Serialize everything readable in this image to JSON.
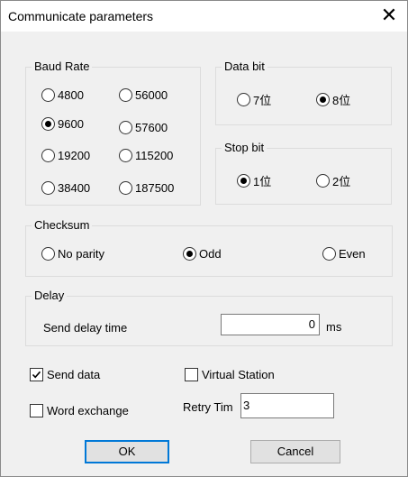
{
  "window": {
    "title": "Communicate parameters",
    "close_glyph": "✕"
  },
  "baud_rate": {
    "label": "Baud Rate",
    "options": [
      "4800",
      "56000",
      "9600",
      "57600",
      "19200",
      "115200",
      "38400",
      "187500"
    ],
    "selected": "9600"
  },
  "data_bit": {
    "label": "Data bit",
    "options": [
      "7位",
      "8位"
    ],
    "selected": "8位"
  },
  "stop_bit": {
    "label": "Stop bit",
    "options": [
      "1位",
      "2位"
    ],
    "selected": "1位"
  },
  "checksum": {
    "label": "Checksum",
    "options": [
      "No parity",
      "Odd",
      "Even"
    ],
    "selected": "Odd"
  },
  "delay": {
    "label": "Delay",
    "send_delay_label": "Send delay time",
    "send_delay_value": "0",
    "unit": "ms"
  },
  "options": {
    "send_data": {
      "label": "Send data",
      "checked": true
    },
    "virtual_station": {
      "label": "Virtual Station",
      "checked": false
    },
    "word_exchange": {
      "label": "Word exchange",
      "checked": false
    },
    "retry_label": "Retry Tim",
    "retry_value": "3"
  },
  "buttons": {
    "ok": "OK",
    "cancel": "Cancel"
  }
}
